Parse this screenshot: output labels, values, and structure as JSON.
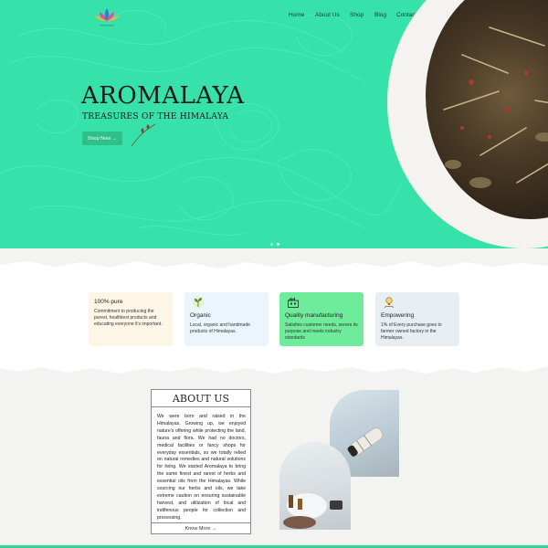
{
  "brand": {
    "logo_text": "Aromalaya"
  },
  "nav": {
    "items": [
      "Home",
      "About Us",
      "Shop",
      "Blog",
      "Contact Us"
    ],
    "icons": [
      "bag-icon",
      "user-icon"
    ]
  },
  "hero": {
    "title": "AROMALAYA",
    "subtitle": "TREASURES OF THE HIMALAYA",
    "cta": "Shop Now →",
    "slides": 2,
    "active_slide": 2,
    "bg_color": "#36e2a9"
  },
  "features": [
    {
      "title": "100% pure",
      "text": "Commitment to producing the purest, healthiest products and educating everyone it's important.",
      "bg": "#fdf6e6",
      "icon": ""
    },
    {
      "title": "Organic",
      "text": "Local, organic and handmade products of Himalayas.",
      "bg": "#eaf5fd",
      "icon": "herb-icon"
    },
    {
      "title": "Quality manufacturing",
      "text": "Satisfies customer needs, serves its purpose and meets industry standards",
      "bg": "#6eec9b",
      "icon": "factory-icon"
    },
    {
      "title": "Empowering",
      "text": "1% of Every purchase goes to farmer owned factory in the Himalayas.",
      "bg": "#e7eef4",
      "icon": "lightbulb-hand-icon"
    }
  ],
  "about": {
    "title": "ABOUT US",
    "text": "We were born and raised in the Himalayas. Growing up, we enjoyed nature's offering while protecting the land, fauna and flora. We had no doctors, medical facilities or fancy shops for everyday essentials, so we totally relied on natural remedies and natural solutions for living. We started Aromalaya to bring the same finest and rarest of herbs and essential oils from the Himalayas. While sourcing our herbs and oils, we take extreme caution on ensuring sustainable harvest, and utilization of local and indifenous people for collection and processing.",
    "cta": "Know More →"
  },
  "colors": {
    "accent": "#2fd69c",
    "hero_bg": "#36e2a9",
    "button": "#2fbf88"
  }
}
